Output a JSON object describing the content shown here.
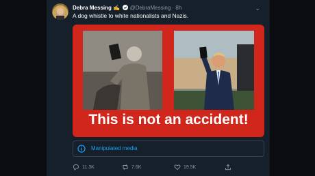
{
  "tweet": {
    "author_name": "Debra Messing",
    "author_emoji": "✍",
    "handle": "@DebraMessing",
    "separator": "·",
    "time": "8h",
    "text": "A dog whistle to white nationalists and Nazis.",
    "media_caption": "This is not an accident!",
    "label": "Manipulated media",
    "replies": "11.3K",
    "retweets": "7.6K",
    "likes": "19.5K"
  },
  "colors": {
    "background": "#15202b",
    "accent": "#1da1f2",
    "media_red": "#d1261c"
  },
  "icons": [
    "verified-badge-icon",
    "chevron-down-icon",
    "info-icon",
    "reply-icon",
    "retweet-icon",
    "like-icon",
    "share-icon"
  ]
}
